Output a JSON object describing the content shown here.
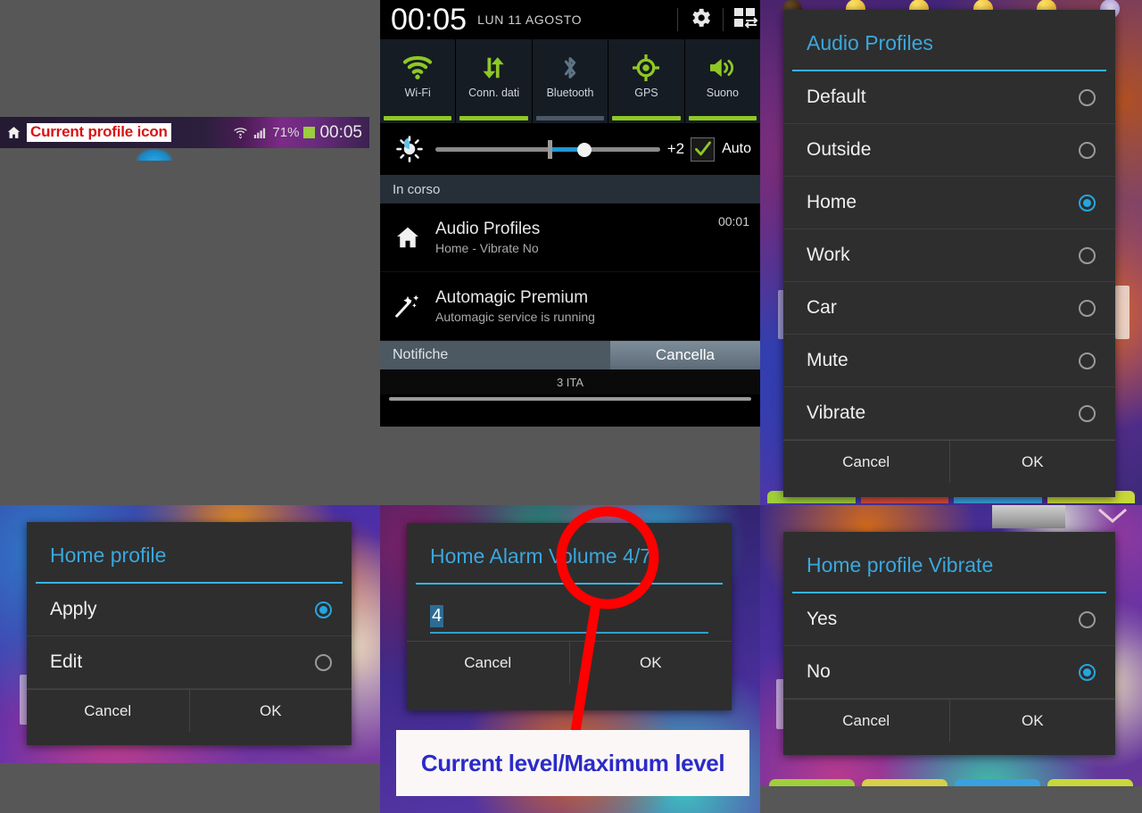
{
  "statusbar": {
    "home_icon": "home-icon",
    "annotation_label": "Current profile icon",
    "wifi_icon": "wifi-icon",
    "signal_icon": "signal-bars-icon",
    "battery_percent": "71%",
    "battery_icon": "battery-icon",
    "clock": "00:05"
  },
  "shade": {
    "clock": "00:05",
    "date": "LUN 11 AGOSTO",
    "settings_icon": "gear-icon",
    "quick_toggle_icon": "quick-settings-grid-icon",
    "toggles": [
      {
        "label": "Wi-Fi",
        "icon": "wifi-icon",
        "state": "on"
      },
      {
        "label": "Conn. dati",
        "icon": "data-connection-icon",
        "state": "on"
      },
      {
        "label": "Bluetooth",
        "icon": "bluetooth-icon",
        "state": "off"
      },
      {
        "label": "GPS",
        "icon": "gps-icon",
        "state": "on"
      },
      {
        "label": "Suono",
        "icon": "sound-icon",
        "state": "on"
      }
    ],
    "brightness": {
      "icon": "brightness-icon",
      "value_label": "+2",
      "auto_label": "Auto",
      "auto_checked": true,
      "check_icon": "check-icon"
    },
    "section_header": "In corso",
    "notifications": [
      {
        "icon": "home-icon",
        "title": "Audio Profiles",
        "subtitle": "Home - Vibrate  No",
        "time": "00:01"
      },
      {
        "icon": "magic-wand-icon",
        "title": "Automagic Premium",
        "subtitle": "Automagic service is running",
        "time": ""
      }
    ],
    "footer_left": "Notifiche",
    "footer_right": "Cancella",
    "carrier": "3 ITA"
  },
  "audio_profiles_dialog": {
    "title": "Audio Profiles",
    "items": [
      {
        "label": "Default",
        "selected": false
      },
      {
        "label": "Outside",
        "selected": false
      },
      {
        "label": "Home",
        "selected": true
      },
      {
        "label": "Work",
        "selected": false
      },
      {
        "label": "Car",
        "selected": false
      },
      {
        "label": "Mute",
        "selected": false
      },
      {
        "label": "Vibrate",
        "selected": false
      }
    ],
    "cancel": "Cancel",
    "ok": "OK"
  },
  "home_profile_dialog": {
    "title": "Home profile",
    "items": [
      {
        "label": "Apply",
        "selected": true
      },
      {
        "label": "Edit",
        "selected": false
      }
    ],
    "cancel": "Cancel",
    "ok": "OK"
  },
  "alarm_volume_dialog": {
    "title": "Home Alarm Volume 4/7",
    "value": "4",
    "cancel": "Cancel",
    "ok": "OK"
  },
  "vibrate_dialog": {
    "title": "Home profile Vibrate",
    "items": [
      {
        "label": "Yes",
        "selected": false
      },
      {
        "label": "No",
        "selected": true
      }
    ],
    "cancel": "Cancel",
    "ok": "OK"
  },
  "annotation": {
    "caption": "Current level/Maximum level",
    "highlight_color": "#ff0000",
    "caption_color": "#2b2bc8"
  }
}
